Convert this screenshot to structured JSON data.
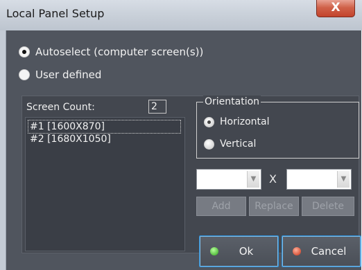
{
  "window": {
    "title": "Local Panel Setup",
    "close_label": "X"
  },
  "mode": {
    "options": [
      {
        "label": "Autoselect (computer screen(s))",
        "checked": true
      },
      {
        "label": "User defined",
        "checked": false
      }
    ]
  },
  "screens": {
    "count_label": "Screen Count:",
    "count_value": "2",
    "items": [
      {
        "label": "#1 [1600X870]",
        "selected": true
      },
      {
        "label": "#2 [1680X1050]",
        "selected": false
      }
    ]
  },
  "orientation": {
    "legend": "Orientation",
    "options": [
      {
        "label": "Horizontal",
        "checked": true
      },
      {
        "label": "Vertical",
        "checked": false
      }
    ]
  },
  "resolution": {
    "width_value": "",
    "height_value": "",
    "separator": "X"
  },
  "actions": {
    "add": "Add",
    "replace": "Replace",
    "delete": "Delete"
  },
  "footer": {
    "ok": "Ok",
    "cancel": "Cancel"
  }
}
